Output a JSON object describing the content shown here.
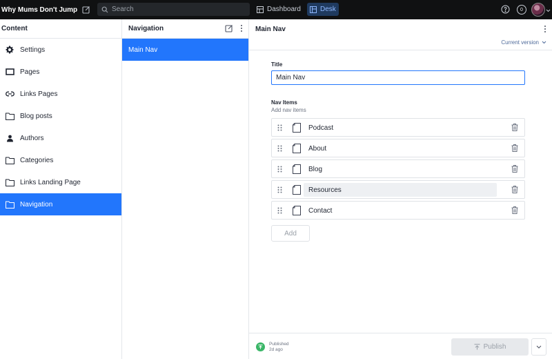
{
  "topbar": {
    "brand": "Why Mums Don't Jump",
    "search_placeholder": "Search",
    "tools": {
      "dashboard": "Dashboard",
      "desk": "Desk"
    },
    "notification_count": "0",
    "icons": [
      "compose-icon",
      "search-icon",
      "dashboard-icon",
      "desk-icon",
      "help-icon",
      "avatar",
      "chevron-down-icon"
    ]
  },
  "content_pane": {
    "title": "Content",
    "items": [
      {
        "label": "Settings",
        "icon": "gear-icon"
      },
      {
        "label": "Pages",
        "icon": "page-icon"
      },
      {
        "label": "Links Pages",
        "icon": "link-icon"
      },
      {
        "label": "Blog posts",
        "icon": "folder-icon"
      },
      {
        "label": "Authors",
        "icon": "person-icon"
      },
      {
        "label": "Categories",
        "icon": "folder-icon"
      },
      {
        "label": "Links Landing Page",
        "icon": "folder-icon"
      },
      {
        "label": "Navigation",
        "icon": "folder-icon",
        "active": true
      }
    ]
  },
  "navigation_pane": {
    "title": "Navigation",
    "items": [
      {
        "label": "Main Nav",
        "active": true
      }
    ]
  },
  "document": {
    "title": "Main Nav",
    "version_label": "Current version",
    "fields": {
      "title_label": "Title",
      "title_value": "Main Nav",
      "nav_items_label": "Nav Items",
      "nav_items_description": "Add nav items"
    },
    "nav_items": [
      {
        "label": "Podcast"
      },
      {
        "label": "About"
      },
      {
        "label": "Blog"
      },
      {
        "label": "Resources",
        "hovered": true
      },
      {
        "label": "Contact"
      }
    ],
    "add_label": "Add",
    "footer": {
      "status": "Published",
      "status_time": "2d ago",
      "publish_label": "Publish"
    }
  },
  "colors": {
    "accent": "#2276fc",
    "topbar": "#101112",
    "published": "#3ab667"
  }
}
